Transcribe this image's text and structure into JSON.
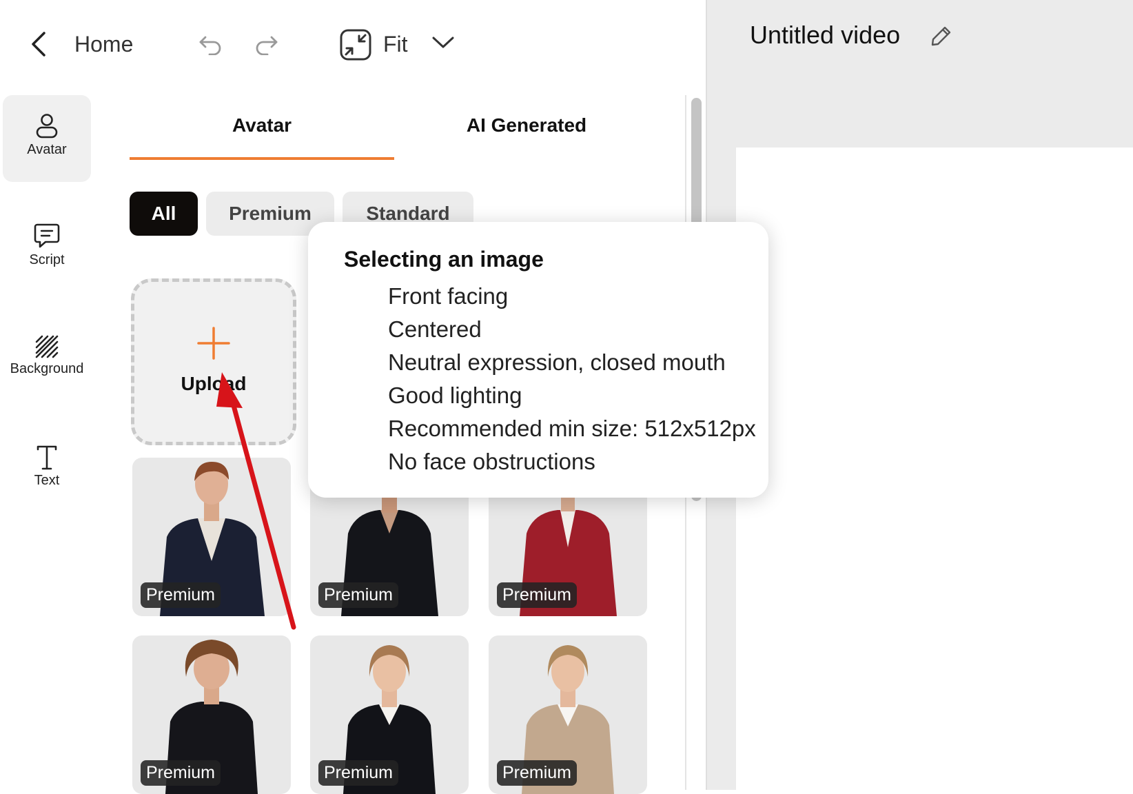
{
  "toolbar": {
    "home_label": "Home",
    "fit_label": "Fit"
  },
  "editor": {
    "video_title": "Untitled video"
  },
  "sidebar": {
    "items": [
      {
        "label": "Avatar",
        "icon": "user-icon",
        "active": true
      },
      {
        "label": "Script",
        "icon": "chat-icon",
        "active": false
      },
      {
        "label": "Background",
        "icon": "hatch-icon",
        "active": false
      },
      {
        "label": "Text",
        "icon": "text-icon",
        "active": false
      }
    ]
  },
  "panel": {
    "tabs": [
      {
        "label": "Avatar",
        "active": true
      },
      {
        "label": "AI Generated",
        "active": false
      }
    ],
    "filters": [
      {
        "label": "All",
        "active": true
      },
      {
        "label": "Premium",
        "active": false
      },
      {
        "label": "Standard",
        "active": false
      }
    ],
    "upload_label": "Upload",
    "avatars": [
      {
        "badge": "Premium"
      },
      {
        "badge": "Premium"
      },
      {
        "badge": "Premium"
      },
      {
        "badge": "Premium"
      },
      {
        "badge": "Premium"
      },
      {
        "badge": "Premium"
      }
    ]
  },
  "tooltip": {
    "title": "Selecting an image",
    "items": [
      "Front facing",
      "Centered",
      "Neutral expression, closed mouth",
      "Good lighting",
      "Recommended min size: 512x512px",
      "No face obstructions"
    ]
  },
  "colors": {
    "accent": "#ef7d32",
    "annotation_arrow": "#d7141a",
    "chip_active": "#0f0c0a"
  }
}
